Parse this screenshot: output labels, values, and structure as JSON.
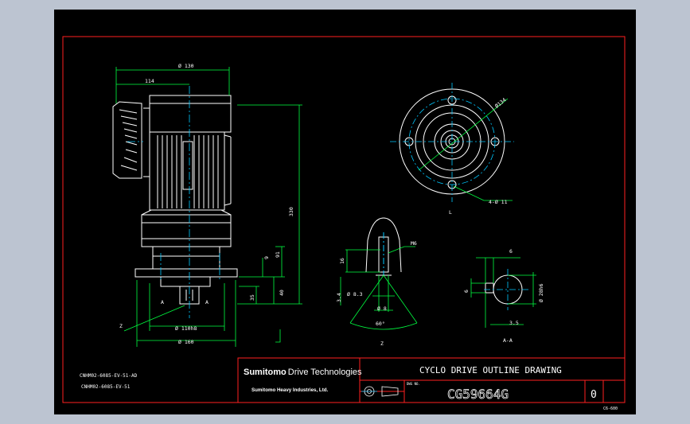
{
  "colors": {
    "background": "#000000",
    "frame_red": "#ff2020",
    "outline_white": "#ffffff",
    "dimension_green": "#00ff40",
    "center_cyan": "#00c8ff",
    "screen_gray": "#bcc4d1"
  },
  "dimensions": {
    "phi130": "Ø 130",
    "d114": "114",
    "d330": "330",
    "d91": "91",
    "d9": "9",
    "d40": "40",
    "d35": "35",
    "phi_110h8": "Ø 110h8",
    "phi160": "Ø 160",
    "callout_z": "Z",
    "label_a_left": "A",
    "label_a_right": "A",
    "phi134": "Ø134",
    "holes": "4-Ø 11",
    "view_mark": "L",
    "m6": "M6",
    "d16": "16",
    "d3_4": "3.4",
    "phi8_3": "Ø 8.3",
    "phi8": "Ø 8",
    "deg60": "60°",
    "view_z": "Z",
    "d6_top": "6",
    "d6_left": "6",
    "phi28h6": "Ø 28h6",
    "d3_5": "3.5",
    "section_aa": "A-A"
  },
  "model_codes": {
    "line1": "CNHM02-6085-EV-51-AD",
    "line2": "CNHM02-6085-EV-51"
  },
  "title_block": {
    "company_bold": "Sumitomo",
    "company_rest": "Drive Technologies",
    "parent_company": "Sumitomo Heavy Industries, Ltd.",
    "drawing_title": "CYCLO DRIVE OUTLINE DRAWING",
    "dwg_label": "DWG NO.",
    "drawing_number": "CG59664G",
    "revision": "0"
  },
  "sheet_code": "C6-600"
}
